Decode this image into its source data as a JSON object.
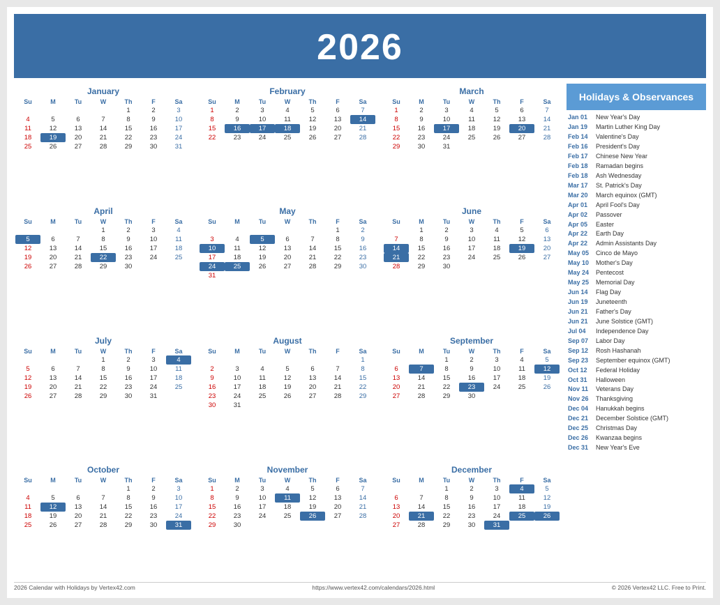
{
  "header": {
    "year": "2026"
  },
  "sidebar": {
    "title": "Holidays & Observances",
    "holidays": [
      {
        "date": "Jan 01",
        "name": "New Year's Day"
      },
      {
        "date": "Jan 19",
        "name": "Martin Luther King Day"
      },
      {
        "date": "Feb 14",
        "name": "Valentine's Day"
      },
      {
        "date": "Feb 16",
        "name": "President's Day"
      },
      {
        "date": "Feb 17",
        "name": "Chinese New Year"
      },
      {
        "date": "Feb 18",
        "name": "Ramadan begins"
      },
      {
        "date": "Feb 18",
        "name": "Ash Wednesday"
      },
      {
        "date": "Mar 17",
        "name": "St. Patrick's Day"
      },
      {
        "date": "Mar 20",
        "name": "March equinox (GMT)"
      },
      {
        "date": "Apr 01",
        "name": "April Fool's Day"
      },
      {
        "date": "Apr 02",
        "name": "Passover"
      },
      {
        "date": "Apr 05",
        "name": "Easter"
      },
      {
        "date": "Apr 22",
        "name": "Earth Day"
      },
      {
        "date": "Apr 22",
        "name": "Admin Assistants Day"
      },
      {
        "date": "May 05",
        "name": "Cinco de Mayo"
      },
      {
        "date": "May 10",
        "name": "Mother's Day"
      },
      {
        "date": "May 24",
        "name": "Pentecost"
      },
      {
        "date": "May 25",
        "name": "Memorial Day"
      },
      {
        "date": "Jun 14",
        "name": "Flag Day"
      },
      {
        "date": "Jun 19",
        "name": "Juneteenth"
      },
      {
        "date": "Jun 21",
        "name": "Father's Day"
      },
      {
        "date": "Jun 21",
        "name": "June Solstice (GMT)"
      },
      {
        "date": "Jul 04",
        "name": "Independence Day"
      },
      {
        "date": "Sep 07",
        "name": "Labor Day"
      },
      {
        "date": "Sep 12",
        "name": "Rosh Hashanah"
      },
      {
        "date": "Sep 23",
        "name": "September equinox (GMT)"
      },
      {
        "date": "Oct 12",
        "name": "Federal Holiday"
      },
      {
        "date": "Oct 31",
        "name": "Halloween"
      },
      {
        "date": "Nov 11",
        "name": "Veterans Day"
      },
      {
        "date": "Nov 26",
        "name": "Thanksgiving"
      },
      {
        "date": "Dec 04",
        "name": "Hanukkah begins"
      },
      {
        "date": "Dec 21",
        "name": "December Solstice (GMT)"
      },
      {
        "date": "Dec 25",
        "name": "Christmas Day"
      },
      {
        "date": "Dec 26",
        "name": "Kwanzaa begins"
      },
      {
        "date": "Dec 31",
        "name": "New Year's Eve"
      }
    ]
  },
  "footer": {
    "left": "2026 Calendar with Holidays by Vertex42.com",
    "center": "https://www.vertex42.com/calendars/2026.html",
    "right": "© 2026 Vertex42 LLC. Free to Print."
  },
  "months": [
    {
      "name": "January",
      "days": [
        [
          "",
          "",
          "",
          "",
          "1",
          "2",
          "3"
        ],
        [
          "4",
          "5",
          "6",
          "7",
          "8",
          "9",
          "10"
        ],
        [
          "11",
          "12",
          "13",
          "14",
          "15",
          "16",
          "17"
        ],
        [
          "18",
          "19h",
          "20",
          "21",
          "22",
          "23",
          "24"
        ],
        [
          "25",
          "26",
          "27",
          "28",
          "29",
          "30",
          "31"
        ]
      ]
    },
    {
      "name": "February",
      "days": [
        [
          "1",
          "2",
          "3",
          "4",
          "5",
          "6",
          "7"
        ],
        [
          "8",
          "9",
          "10",
          "11",
          "12",
          "13",
          "14h"
        ],
        [
          "15",
          "16h",
          "17h",
          "18h",
          "19",
          "20",
          "21"
        ],
        [
          "22",
          "23",
          "24",
          "25",
          "26",
          "27",
          "28"
        ]
      ]
    },
    {
      "name": "March",
      "days": [
        [
          "1",
          "2",
          "3",
          "4",
          "5",
          "6",
          "7"
        ],
        [
          "8",
          "9",
          "10",
          "11",
          "12",
          "13",
          "14"
        ],
        [
          "15",
          "16",
          "17h",
          "18",
          "19",
          "20h",
          "21"
        ],
        [
          "22",
          "23",
          "24",
          "25",
          "26",
          "27",
          "28"
        ],
        [
          "29",
          "30",
          "31",
          "",
          "",
          "",
          ""
        ]
      ]
    },
    {
      "name": "April",
      "days": [
        [
          "",
          "",
          "",
          "1",
          "2",
          "3",
          "4"
        ],
        [
          "5h",
          "6",
          "7",
          "8",
          "9",
          "10",
          "11"
        ],
        [
          "12",
          "13",
          "14",
          "15",
          "16",
          "17",
          "18"
        ],
        [
          "19",
          "20",
          "21",
          "22h",
          "23",
          "24",
          "25"
        ],
        [
          "26",
          "27",
          "28",
          "29",
          "30",
          "",
          ""
        ]
      ]
    },
    {
      "name": "May",
      "days": [
        [
          "",
          "",
          "",
          "",
          "",
          "1",
          "2"
        ],
        [
          "3",
          "4",
          "5h",
          "6",
          "7",
          "8",
          "9"
        ],
        [
          "10h",
          "11",
          "12",
          "13",
          "14",
          "15",
          "16"
        ],
        [
          "17",
          "18",
          "19",
          "20",
          "21",
          "22",
          "23"
        ],
        [
          "24h",
          "25h",
          "26",
          "27",
          "28",
          "29",
          "30"
        ],
        [
          "31",
          "",
          "",
          "",
          "",
          "",
          ""
        ]
      ]
    },
    {
      "name": "June",
      "days": [
        [
          "",
          "1",
          "2",
          "3",
          "4",
          "5",
          "6"
        ],
        [
          "7",
          "8",
          "9",
          "10",
          "11",
          "12",
          "13"
        ],
        [
          "14h",
          "15",
          "16",
          "17",
          "18",
          "19h",
          "20"
        ],
        [
          "21h",
          "22",
          "23",
          "24",
          "25",
          "26",
          "27"
        ],
        [
          "28",
          "29",
          "30",
          "",
          "",
          "",
          ""
        ]
      ]
    },
    {
      "name": "July",
      "days": [
        [
          "",
          "",
          "",
          "1",
          "2",
          "3",
          "4h"
        ],
        [
          "5",
          "6",
          "7",
          "8",
          "9",
          "10",
          "11"
        ],
        [
          "12",
          "13",
          "14",
          "15",
          "16",
          "17",
          "18"
        ],
        [
          "19",
          "20",
          "21",
          "22",
          "23",
          "24",
          "25"
        ],
        [
          "26",
          "27",
          "28",
          "29",
          "30",
          "31",
          ""
        ]
      ]
    },
    {
      "name": "August",
      "days": [
        [
          "",
          "",
          "",
          "",
          "",
          "",
          "1"
        ],
        [
          "2",
          "3",
          "4",
          "5",
          "6",
          "7",
          "8"
        ],
        [
          "9",
          "10",
          "11",
          "12",
          "13",
          "14",
          "15"
        ],
        [
          "16",
          "17",
          "18",
          "19",
          "20",
          "21",
          "22"
        ],
        [
          "23",
          "24",
          "25",
          "26",
          "27",
          "28",
          "29"
        ],
        [
          "30",
          "31",
          "",
          "",
          "",
          "",
          ""
        ]
      ]
    },
    {
      "name": "September",
      "days": [
        [
          "",
          "",
          "1",
          "2",
          "3",
          "4",
          "5"
        ],
        [
          "6",
          "7h",
          "8",
          "9",
          "10",
          "11",
          "12h"
        ],
        [
          "13",
          "14",
          "15",
          "16",
          "17",
          "18",
          "19"
        ],
        [
          "20",
          "21",
          "22",
          "23h",
          "24",
          "25",
          "26"
        ],
        [
          "27",
          "28",
          "29",
          "30",
          "",
          "",
          ""
        ]
      ]
    },
    {
      "name": "October",
      "days": [
        [
          "",
          "",
          "",
          "",
          "1",
          "2",
          "3"
        ],
        [
          "4",
          "5",
          "6",
          "7",
          "8",
          "9",
          "10"
        ],
        [
          "11",
          "12h",
          "13",
          "14",
          "15",
          "16",
          "17"
        ],
        [
          "18",
          "19",
          "20",
          "21",
          "22",
          "23",
          "24"
        ],
        [
          "25",
          "26",
          "27",
          "28",
          "29",
          "30",
          "31h"
        ]
      ]
    },
    {
      "name": "November",
      "days": [
        [
          "1",
          "2",
          "3",
          "4",
          "5",
          "6",
          "7"
        ],
        [
          "8",
          "9",
          "10",
          "11h",
          "12",
          "13",
          "14"
        ],
        [
          "15",
          "16",
          "17",
          "18",
          "19",
          "20",
          "21"
        ],
        [
          "22",
          "23",
          "24",
          "25",
          "26h",
          "27",
          "28"
        ],
        [
          "29",
          "30",
          "",
          "",
          "",
          "",
          ""
        ]
      ]
    },
    {
      "name": "December",
      "days": [
        [
          "",
          "",
          "1",
          "2",
          "3",
          "4h",
          "5"
        ],
        [
          "6",
          "7",
          "8",
          "9",
          "10",
          "11",
          "12"
        ],
        [
          "13",
          "14",
          "15",
          "16",
          "17",
          "18",
          "19"
        ],
        [
          "20",
          "21h",
          "22",
          "23",
          "24",
          "25h",
          "26h"
        ],
        [
          "27",
          "28",
          "29",
          "30",
          "31h",
          "",
          ""
        ]
      ]
    }
  ]
}
